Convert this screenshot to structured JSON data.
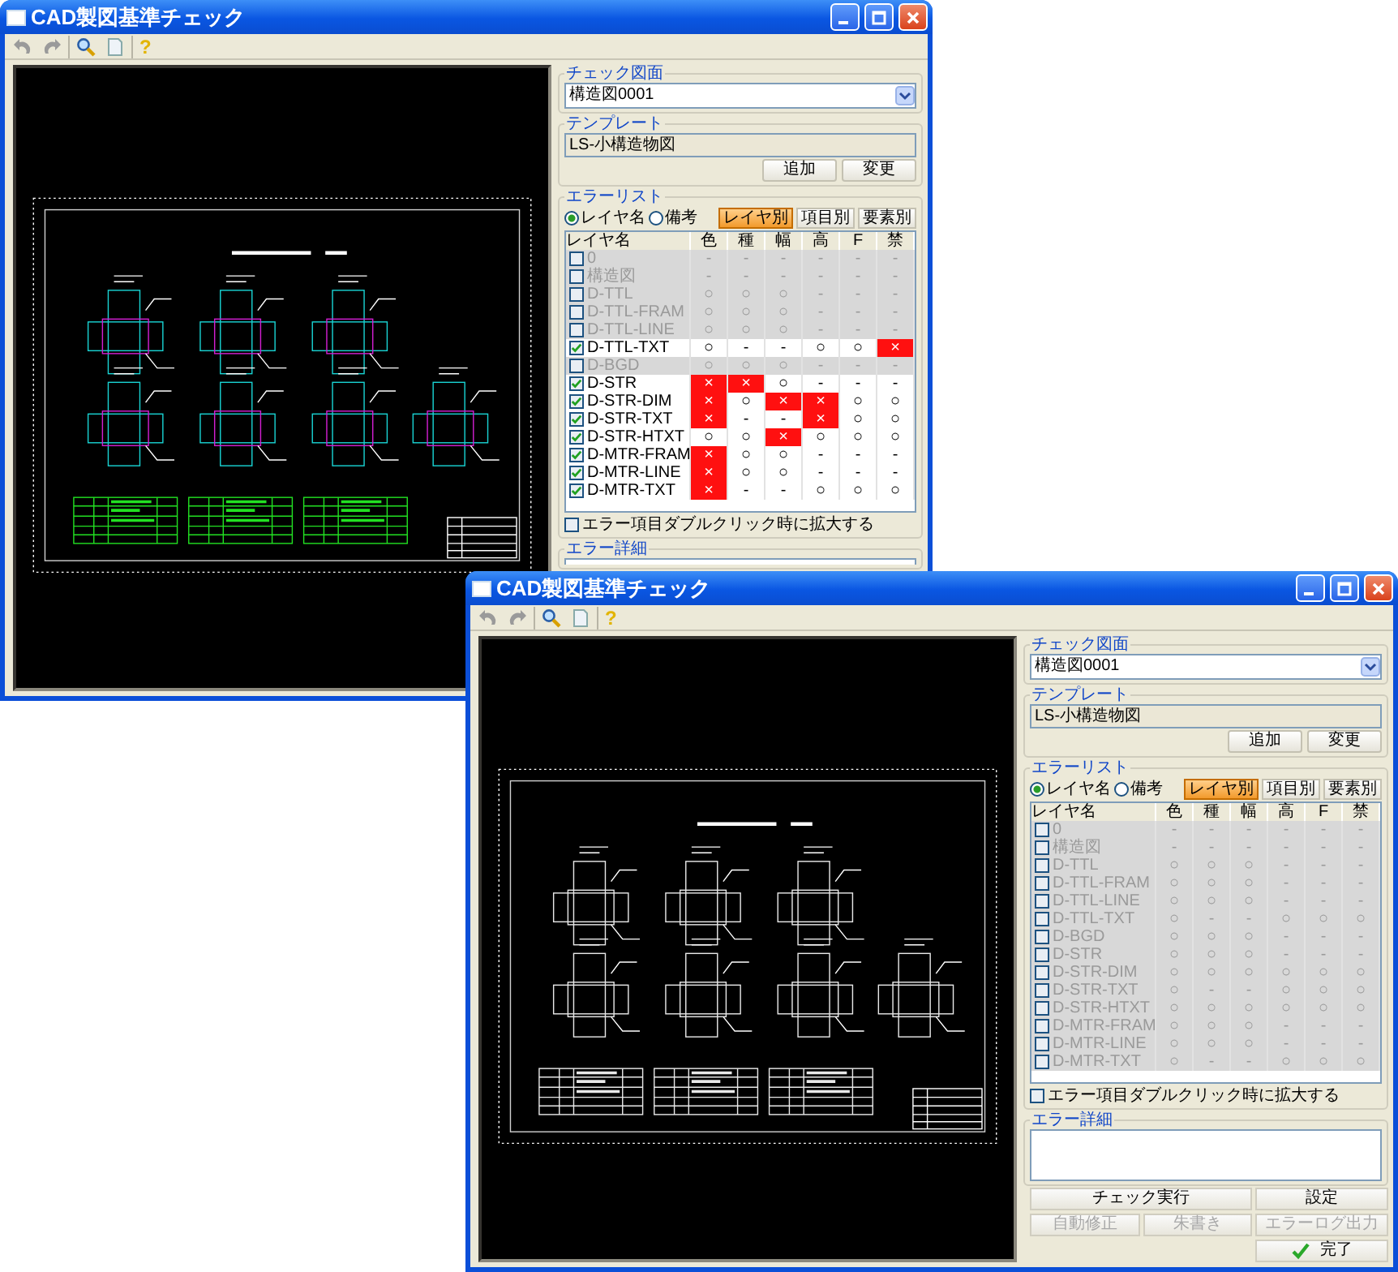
{
  "windows": [
    {
      "title": "CAD製図基準チェック",
      "toolbar": [
        {
          "kind": "undo"
        },
        {
          "kind": "redo"
        },
        {
          "kind": "search"
        },
        {
          "kind": "document"
        },
        {
          "kind": "help",
          "glyph": "?"
        }
      ],
      "drawing": {
        "kind": "color"
      },
      "panel": {
        "check_drawing": {
          "label": "チェック図面",
          "value": "構造図0001"
        },
        "template": {
          "label": "テンプレート",
          "value": "LS-小構造物図",
          "buttons": [
            "追加",
            "変更"
          ]
        },
        "error_list": {
          "label": "エラーリスト",
          "radios": [
            {
              "label": "レイヤ名",
              "selected": true
            },
            {
              "label": "備考",
              "selected": false
            }
          ],
          "tabs": [
            {
              "label": "レイヤ別",
              "selected": true
            },
            {
              "label": "項目別",
              "selected": false
            },
            {
              "label": "要素別",
              "selected": false
            }
          ],
          "name_column": "レイヤ名",
          "columns": [
            "色",
            "種",
            "幅",
            "高",
            "F",
            "禁"
          ],
          "rows": [
            {
              "name": "0",
              "checked": false,
              "cells": [
                {
                  "text": "-",
                  "error": false
                },
                {
                  "text": "-",
                  "error": false
                },
                {
                  "text": "-",
                  "error": false
                },
                {
                  "text": "-",
                  "error": false
                },
                {
                  "text": "-",
                  "error": false
                },
                {
                  "text": "-",
                  "error": false
                }
              ]
            },
            {
              "name": "構造図",
              "checked": false,
              "cells": [
                {
                  "text": "-",
                  "error": false
                },
                {
                  "text": "-",
                  "error": false
                },
                {
                  "text": "-",
                  "error": false
                },
                {
                  "text": "-",
                  "error": false
                },
                {
                  "text": "-",
                  "error": false
                },
                {
                  "text": "-",
                  "error": false
                }
              ]
            },
            {
              "name": "D-TTL",
              "checked": false,
              "cells": [
                {
                  "text": "○",
                  "error": false
                },
                {
                  "text": "○",
                  "error": false
                },
                {
                  "text": "○",
                  "error": false
                },
                {
                  "text": "-",
                  "error": false
                },
                {
                  "text": "-",
                  "error": false
                },
                {
                  "text": "-",
                  "error": false
                }
              ]
            },
            {
              "name": "D-TTL-FRAM",
              "checked": false,
              "cells": [
                {
                  "text": "○",
                  "error": false
                },
                {
                  "text": "○",
                  "error": false
                },
                {
                  "text": "○",
                  "error": false
                },
                {
                  "text": "-",
                  "error": false
                },
                {
                  "text": "-",
                  "error": false
                },
                {
                  "text": "-",
                  "error": false
                }
              ]
            },
            {
              "name": "D-TTL-LINE",
              "checked": false,
              "cells": [
                {
                  "text": "○",
                  "error": false
                },
                {
                  "text": "○",
                  "error": false
                },
                {
                  "text": "○",
                  "error": false
                },
                {
                  "text": "-",
                  "error": false
                },
                {
                  "text": "-",
                  "error": false
                },
                {
                  "text": "-",
                  "error": false
                }
              ]
            },
            {
              "name": "D-TTL-TXT",
              "checked": true,
              "cells": [
                {
                  "text": "○",
                  "error": false
                },
                {
                  "text": "-",
                  "error": false
                },
                {
                  "text": "-",
                  "error": false
                },
                {
                  "text": "○",
                  "error": false
                },
                {
                  "text": "○",
                  "error": false
                },
                {
                  "text": "×",
                  "error": true
                }
              ]
            },
            {
              "name": "D-BGD",
              "checked": false,
              "cells": [
                {
                  "text": "○",
                  "error": false
                },
                {
                  "text": "○",
                  "error": false
                },
                {
                  "text": "○",
                  "error": false
                },
                {
                  "text": "-",
                  "error": false
                },
                {
                  "text": "-",
                  "error": false
                },
                {
                  "text": "-",
                  "error": false
                }
              ]
            },
            {
              "name": "D-STR",
              "checked": true,
              "cells": [
                {
                  "text": "×",
                  "error": true
                },
                {
                  "text": "×",
                  "error": true
                },
                {
                  "text": "○",
                  "error": false
                },
                {
                  "text": "-",
                  "error": false
                },
                {
                  "text": "-",
                  "error": false
                },
                {
                  "text": "-",
                  "error": false
                }
              ]
            },
            {
              "name": "D-STR-DIM",
              "checked": true,
              "cells": [
                {
                  "text": "×",
                  "error": true
                },
                {
                  "text": "○",
                  "error": false
                },
                {
                  "text": "×",
                  "error": true
                },
                {
                  "text": "×",
                  "error": true
                },
                {
                  "text": "○",
                  "error": false
                },
                {
                  "text": "○",
                  "error": false
                }
              ]
            },
            {
              "name": "D-STR-TXT",
              "checked": true,
              "cells": [
                {
                  "text": "×",
                  "error": true
                },
                {
                  "text": "-",
                  "error": false
                },
                {
                  "text": "-",
                  "error": false
                },
                {
                  "text": "×",
                  "error": true
                },
                {
                  "text": "○",
                  "error": false
                },
                {
                  "text": "○",
                  "error": false
                }
              ]
            },
            {
              "name": "D-STR-HTXT",
              "checked": true,
              "cells": [
                {
                  "text": "○",
                  "error": false
                },
                {
                  "text": "○",
                  "error": false
                },
                {
                  "text": "×",
                  "error": true
                },
                {
                  "text": "○",
                  "error": false
                },
                {
                  "text": "○",
                  "error": false
                },
                {
                  "text": "○",
                  "error": false
                }
              ]
            },
            {
              "name": "D-MTR-FRAM",
              "checked": true,
              "cells": [
                {
                  "text": "×",
                  "error": true
                },
                {
                  "text": "○",
                  "error": false
                },
                {
                  "text": "○",
                  "error": false
                },
                {
                  "text": "-",
                  "error": false
                },
                {
                  "text": "-",
                  "error": false
                },
                {
                  "text": "-",
                  "error": false
                }
              ]
            },
            {
              "name": "D-MTR-LINE",
              "checked": true,
              "cells": [
                {
                  "text": "×",
                  "error": true
                },
                {
                  "text": "○",
                  "error": false
                },
                {
                  "text": "○",
                  "error": false
                },
                {
                  "text": "-",
                  "error": false
                },
                {
                  "text": "-",
                  "error": false
                },
                {
                  "text": "-",
                  "error": false
                }
              ]
            },
            {
              "name": "D-MTR-TXT",
              "checked": true,
              "cells": [
                {
                  "text": "×",
                  "error": true
                },
                {
                  "text": "-",
                  "error": false
                },
                {
                  "text": "-",
                  "error": false
                },
                {
                  "text": "○",
                  "error": false
                },
                {
                  "text": "○",
                  "error": false
                },
                {
                  "text": "○",
                  "error": false
                }
              ]
            }
          ]
        },
        "zoom_option": {
          "label": "エラー項目ダブルクリック時に拡大する",
          "checked": false
        },
        "error_detail": {
          "label": "エラー詳細"
        }
      }
    },
    {
      "title": "CAD製図基準チェック",
      "toolbar": [
        {
          "kind": "undo"
        },
        {
          "kind": "redo"
        },
        {
          "kind": "search"
        },
        {
          "kind": "document"
        },
        {
          "kind": "help",
          "glyph": "?"
        }
      ],
      "drawing": {
        "kind": "mono"
      },
      "panel": {
        "check_drawing": {
          "label": "チェック図面",
          "value": "構造図0001"
        },
        "template": {
          "label": "テンプレート",
          "value": "LS-小構造物図",
          "buttons": [
            "追加",
            "変更"
          ]
        },
        "error_list": {
          "label": "エラーリスト",
          "radios": [
            {
              "label": "レイヤ名",
              "selected": true
            },
            {
              "label": "備考",
              "selected": false
            }
          ],
          "tabs": [
            {
              "label": "レイヤ別",
              "selected": true
            },
            {
              "label": "項目別",
              "selected": false
            },
            {
              "label": "要素別",
              "selected": false
            }
          ],
          "name_column": "レイヤ名",
          "columns": [
            "色",
            "種",
            "幅",
            "高",
            "F",
            "禁"
          ],
          "rows": [
            {
              "name": "0",
              "checked": false,
              "cells": [
                {
                  "text": "-",
                  "error": false
                },
                {
                  "text": "-",
                  "error": false
                },
                {
                  "text": "-",
                  "error": false
                },
                {
                  "text": "-",
                  "error": false
                },
                {
                  "text": "-",
                  "error": false
                },
                {
                  "text": "-",
                  "error": false
                }
              ]
            },
            {
              "name": "構造図",
              "checked": false,
              "cells": [
                {
                  "text": "-",
                  "error": false
                },
                {
                  "text": "-",
                  "error": false
                },
                {
                  "text": "-",
                  "error": false
                },
                {
                  "text": "-",
                  "error": false
                },
                {
                  "text": "-",
                  "error": false
                },
                {
                  "text": "-",
                  "error": false
                }
              ]
            },
            {
              "name": "D-TTL",
              "checked": false,
              "cells": [
                {
                  "text": "○",
                  "error": false
                },
                {
                  "text": "○",
                  "error": false
                },
                {
                  "text": "○",
                  "error": false
                },
                {
                  "text": "-",
                  "error": false
                },
                {
                  "text": "-",
                  "error": false
                },
                {
                  "text": "-",
                  "error": false
                }
              ]
            },
            {
              "name": "D-TTL-FRAM",
              "checked": false,
              "cells": [
                {
                  "text": "○",
                  "error": false
                },
                {
                  "text": "○",
                  "error": false
                },
                {
                  "text": "○",
                  "error": false
                },
                {
                  "text": "-",
                  "error": false
                },
                {
                  "text": "-",
                  "error": false
                },
                {
                  "text": "-",
                  "error": false
                }
              ]
            },
            {
              "name": "D-TTL-LINE",
              "checked": false,
              "cells": [
                {
                  "text": "○",
                  "error": false
                },
                {
                  "text": "○",
                  "error": false
                },
                {
                  "text": "○",
                  "error": false
                },
                {
                  "text": "-",
                  "error": false
                },
                {
                  "text": "-",
                  "error": false
                },
                {
                  "text": "-",
                  "error": false
                }
              ]
            },
            {
              "name": "D-TTL-TXT",
              "checked": false,
              "cells": [
                {
                  "text": "○",
                  "error": false
                },
                {
                  "text": "-",
                  "error": false
                },
                {
                  "text": "-",
                  "error": false
                },
                {
                  "text": "○",
                  "error": false
                },
                {
                  "text": "○",
                  "error": false
                },
                {
                  "text": "○",
                  "error": false
                }
              ]
            },
            {
              "name": "D-BGD",
              "checked": false,
              "cells": [
                {
                  "text": "○",
                  "error": false
                },
                {
                  "text": "○",
                  "error": false
                },
                {
                  "text": "○",
                  "error": false
                },
                {
                  "text": "-",
                  "error": false
                },
                {
                  "text": "-",
                  "error": false
                },
                {
                  "text": "-",
                  "error": false
                }
              ]
            },
            {
              "name": "D-STR",
              "checked": false,
              "cells": [
                {
                  "text": "○",
                  "error": false
                },
                {
                  "text": "○",
                  "error": false
                },
                {
                  "text": "○",
                  "error": false
                },
                {
                  "text": "-",
                  "error": false
                },
                {
                  "text": "-",
                  "error": false
                },
                {
                  "text": "-",
                  "error": false
                }
              ]
            },
            {
              "name": "D-STR-DIM",
              "checked": false,
              "cells": [
                {
                  "text": "○",
                  "error": false
                },
                {
                  "text": "○",
                  "error": false
                },
                {
                  "text": "○",
                  "error": false
                },
                {
                  "text": "○",
                  "error": false
                },
                {
                  "text": "○",
                  "error": false
                },
                {
                  "text": "○",
                  "error": false
                }
              ]
            },
            {
              "name": "D-STR-TXT",
              "checked": false,
              "cells": [
                {
                  "text": "○",
                  "error": false
                },
                {
                  "text": "-",
                  "error": false
                },
                {
                  "text": "-",
                  "error": false
                },
                {
                  "text": "○",
                  "error": false
                },
                {
                  "text": "○",
                  "error": false
                },
                {
                  "text": "○",
                  "error": false
                }
              ]
            },
            {
              "name": "D-STR-HTXT",
              "checked": false,
              "cells": [
                {
                  "text": "○",
                  "error": false
                },
                {
                  "text": "○",
                  "error": false
                },
                {
                  "text": "○",
                  "error": false
                },
                {
                  "text": "○",
                  "error": false
                },
                {
                  "text": "○",
                  "error": false
                },
                {
                  "text": "○",
                  "error": false
                }
              ]
            },
            {
              "name": "D-MTR-FRAM",
              "checked": false,
              "cells": [
                {
                  "text": "○",
                  "error": false
                },
                {
                  "text": "○",
                  "error": false
                },
                {
                  "text": "○",
                  "error": false
                },
                {
                  "text": "-",
                  "error": false
                },
                {
                  "text": "-",
                  "error": false
                },
                {
                  "text": "-",
                  "error": false
                }
              ]
            },
            {
              "name": "D-MTR-LINE",
              "checked": false,
              "cells": [
                {
                  "text": "○",
                  "error": false
                },
                {
                  "text": "○",
                  "error": false
                },
                {
                  "text": "○",
                  "error": false
                },
                {
                  "text": "-",
                  "error": false
                },
                {
                  "text": "-",
                  "error": false
                },
                {
                  "text": "-",
                  "error": false
                }
              ]
            },
            {
              "name": "D-MTR-TXT",
              "checked": false,
              "cells": [
                {
                  "text": "○",
                  "error": false
                },
                {
                  "text": "-",
                  "error": false
                },
                {
                  "text": "-",
                  "error": false
                },
                {
                  "text": "○",
                  "error": false
                },
                {
                  "text": "○",
                  "error": false
                },
                {
                  "text": "○",
                  "error": false
                }
              ]
            }
          ]
        },
        "zoom_option": {
          "label": "エラー項目ダブルクリック時に拡大する",
          "checked": false
        },
        "error_detail": {
          "label": "エラー詳細"
        },
        "actions": [
          {
            "label": "チェック実行",
            "kind": "wide",
            "disabled": false
          },
          {
            "label": "設定",
            "kind": "plain",
            "disabled": false
          },
          {
            "label": "自動修正",
            "kind": "plain",
            "disabled": true
          },
          {
            "label": "朱書き",
            "kind": "plain",
            "disabled": true
          },
          {
            "label": "エラーログ出力",
            "kind": "plain",
            "disabled": true
          },
          {
            "label": "完了",
            "kind": "ok",
            "disabled": false
          }
        ]
      }
    }
  ]
}
